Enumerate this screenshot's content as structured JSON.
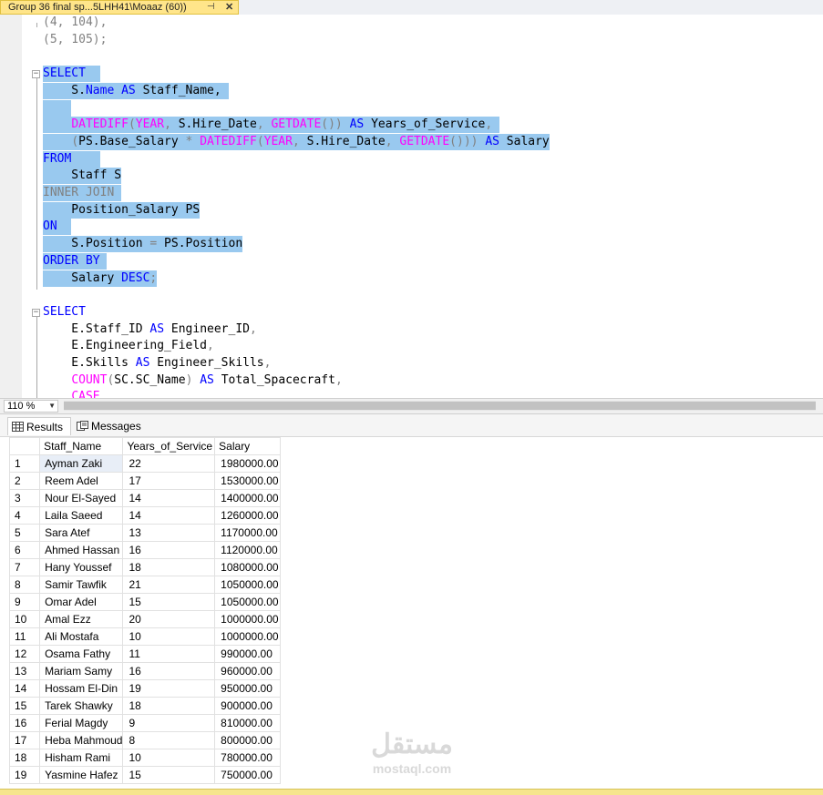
{
  "tab": {
    "title": "Group 36 final  sp...5LHH41\\Moaaz (60))",
    "pin": "⊣",
    "close": "✕"
  },
  "editor": {
    "lines": [
      [
        {
          "t": "(4, 104),",
          "c": "op"
        }
      ],
      [
        {
          "t": "(5, 105);",
          "c": "op"
        }
      ],
      [],
      [
        {
          "t": "SELECT",
          "c": "kw"
        },
        {
          "t": "  ",
          "c": ""
        }
      ],
      [
        {
          "t": "    S.",
          "c": ""
        },
        {
          "t": "Name",
          "c": "kw"
        },
        {
          "t": " ",
          "c": ""
        },
        {
          "t": "AS",
          "c": "kw"
        },
        {
          "t": " Staff_Name,",
          "c": ""
        },
        {
          "t": " ",
          "c": ""
        }
      ],
      [
        {
          "t": "    ",
          "c": ""
        }
      ],
      [
        {
          "t": "    ",
          "c": ""
        },
        {
          "t": "DATEDIFF",
          "c": "fn"
        },
        {
          "t": "(",
          "c": "op"
        },
        {
          "t": "YEAR",
          "c": "fn"
        },
        {
          "t": ",",
          "c": "op"
        },
        {
          "t": " S.Hire_Date",
          "c": ""
        },
        {
          "t": ",",
          "c": "op"
        },
        {
          "t": " ",
          "c": ""
        },
        {
          "t": "GETDATE",
          "c": "fn"
        },
        {
          "t": "())",
          "c": "op"
        },
        {
          "t": " ",
          "c": ""
        },
        {
          "t": "AS",
          "c": "kw"
        },
        {
          "t": " Years_of_Service",
          "c": ""
        },
        {
          "t": ",",
          "c": "op"
        },
        {
          "t": " ",
          "c": ""
        }
      ],
      [
        {
          "t": "    ",
          "c": ""
        },
        {
          "t": "(",
          "c": "op"
        },
        {
          "t": "PS.Base_Salary ",
          "c": ""
        },
        {
          "t": "*",
          "c": "op"
        },
        {
          "t": " ",
          "c": ""
        },
        {
          "t": "DATEDIFF",
          "c": "fn"
        },
        {
          "t": "(",
          "c": "op"
        },
        {
          "t": "YEAR",
          "c": "fn"
        },
        {
          "t": ",",
          "c": "op"
        },
        {
          "t": " S.Hire_Date",
          "c": ""
        },
        {
          "t": ",",
          "c": "op"
        },
        {
          "t": " ",
          "c": ""
        },
        {
          "t": "GETDATE",
          "c": "fn"
        },
        {
          "t": "()))",
          "c": "op"
        },
        {
          "t": " ",
          "c": ""
        },
        {
          "t": "AS",
          "c": "kw"
        },
        {
          "t": " Salary",
          "c": ""
        }
      ],
      [
        {
          "t": "FROM",
          "c": "kw"
        },
        {
          "t": "    ",
          "c": ""
        }
      ],
      [
        {
          "t": "    Staff S",
          "c": ""
        }
      ],
      [
        {
          "t": "INNER JOIN",
          "c": "op"
        },
        {
          "t": " ",
          "c": ""
        }
      ],
      [
        {
          "t": "    Position_Salary PS",
          "c": ""
        }
      ],
      [
        {
          "t": "ON",
          "c": "kw"
        },
        {
          "t": "  ",
          "c": ""
        }
      ],
      [
        {
          "t": "    S.Position ",
          "c": ""
        },
        {
          "t": "=",
          "c": "op"
        },
        {
          "t": " PS.Position",
          "c": ""
        }
      ],
      [
        {
          "t": "ORDER BY",
          "c": "kw"
        },
        {
          "t": " ",
          "c": ""
        }
      ],
      [
        {
          "t": "    Salary ",
          "c": ""
        },
        {
          "t": "DESC",
          "c": "kw"
        },
        {
          "t": ";",
          "c": "op"
        }
      ],
      [],
      [
        {
          "t": "SELECT",
          "c": "kw"
        }
      ],
      [
        {
          "t": "    E.Staff_ID ",
          "c": ""
        },
        {
          "t": "AS",
          "c": "kw"
        },
        {
          "t": " Engineer_ID",
          "c": ""
        },
        {
          "t": ",",
          "c": "op"
        }
      ],
      [
        {
          "t": "    E.Engineering_Field",
          "c": ""
        },
        {
          "t": ",",
          "c": "op"
        }
      ],
      [
        {
          "t": "    E.Skills ",
          "c": ""
        },
        {
          "t": "AS",
          "c": "kw"
        },
        {
          "t": " Engineer_Skills",
          "c": ""
        },
        {
          "t": ",",
          "c": "op"
        }
      ],
      [
        {
          "t": "    ",
          "c": ""
        },
        {
          "t": "COUNT",
          "c": "fn"
        },
        {
          "t": "(",
          "c": "op"
        },
        {
          "t": "SC.SC_Name",
          "c": ""
        },
        {
          "t": ")",
          "c": "op"
        },
        {
          "t": " ",
          "c": ""
        },
        {
          "t": "AS",
          "c": "kw"
        },
        {
          "t": " Total_Spacecraft",
          "c": ""
        },
        {
          "t": ",",
          "c": "op"
        }
      ],
      [
        {
          "t": "    ",
          "c": ""
        },
        {
          "t": "CASE",
          "c": "fn"
        }
      ]
    ],
    "selected_lines": [
      3,
      4,
      5,
      6,
      7,
      8,
      9,
      10,
      11,
      12,
      13,
      14,
      15
    ]
  },
  "zoom": {
    "value": "110 %"
  },
  "results_tabs": {
    "results": "Results",
    "messages": "Messages"
  },
  "grid": {
    "columns": [
      "Staff_Name",
      "Years_of_Service",
      "Salary"
    ],
    "rows": [
      [
        "1",
        "Ayman Zaki",
        "22",
        "1980000.00"
      ],
      [
        "2",
        "Reem Adel",
        "17",
        "1530000.00"
      ],
      [
        "3",
        "Nour El-Sayed",
        "14",
        "1400000.00"
      ],
      [
        "4",
        "Laila Saeed",
        "14",
        "1260000.00"
      ],
      [
        "5",
        "Sara Atef",
        "13",
        "1170000.00"
      ],
      [
        "6",
        "Ahmed Hassan",
        "16",
        "1120000.00"
      ],
      [
        "7",
        "Hany Youssef",
        "18",
        "1080000.00"
      ],
      [
        "8",
        "Samir Tawfik",
        "21",
        "1050000.00"
      ],
      [
        "9",
        "Omar Adel",
        "15",
        "1050000.00"
      ],
      [
        "10",
        "Amal Ezz",
        "20",
        "1000000.00"
      ],
      [
        "11",
        "Ali Mostafa",
        "10",
        "1000000.00"
      ],
      [
        "12",
        "Osama Fathy",
        "11",
        "990000.00"
      ],
      [
        "13",
        "Mariam Samy",
        "16",
        "960000.00"
      ],
      [
        "14",
        "Hossam El-Din",
        "19",
        "950000.00"
      ],
      [
        "15",
        "Tarek Shawky",
        "18",
        "900000.00"
      ],
      [
        "16",
        "Ferial Magdy",
        "9",
        "810000.00"
      ],
      [
        "17",
        "Heba Mahmoud",
        "8",
        "800000.00"
      ],
      [
        "18",
        "Hisham Rami",
        "10",
        "780000.00"
      ],
      [
        "19",
        "Yasmine Hafez",
        "15",
        "750000.00"
      ]
    ]
  },
  "watermark": {
    "arabic": "مستقل",
    "latin": "mostaql.com"
  },
  "colors": {
    "selection": "#99c9ef",
    "keyword": "#0000ff",
    "function": "#ff00ff",
    "operator": "#808080",
    "tab": "#ffe58a"
  }
}
